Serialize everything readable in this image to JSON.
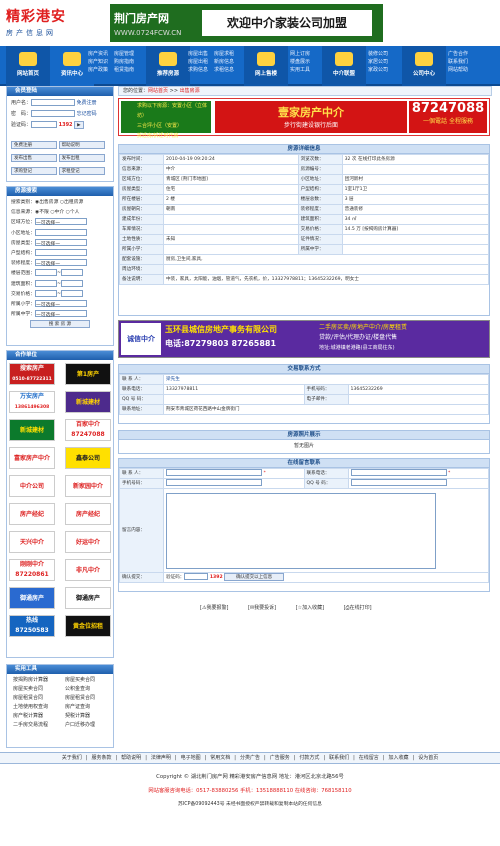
{
  "logo": {
    "main": "精彩港安",
    "sub": "房产信息网"
  },
  "banner_top": {
    "name": "荆门房产网",
    "url": "WWW.0724FCW.CN",
    "slogan": "欢迎中介家装公司加盟"
  },
  "nav": {
    "home": "网站首页",
    "news": "资讯中心",
    "recommend": "推荐房源",
    "online": "网上售楼",
    "agents": "中介联盟",
    "company": "公司中心",
    "cols": [
      [
        "房产资讯",
        "房产知识",
        "房产政策"
      ],
      [
        "房屋管理",
        "购房指南",
        "租赁指南"
      ],
      [
        "房屋指南",
        "评估指南",
        "市场走势"
      ],
      [
        "房屋出售",
        "房屋出租",
        "求购信息"
      ],
      [
        "房屋求租",
        "新房信息",
        "求租信息"
      ],
      [
        "网上订房",
        "楼盘展示",
        "实用工具"
      ],
      [
        "装修公司",
        "家居公司",
        "家政公司"
      ],
      [
        "广告合作",
        "联系我们",
        "网站帮助"
      ]
    ]
  },
  "breadcrumb": {
    "prefix": "您的位置：",
    "home": "网站首页",
    "sep": ">>",
    "current": "出售房源"
  },
  "login": {
    "title": "会员登陆",
    "user": "用户名：",
    "pwd": "密　码：",
    "code": "验证码：",
    "code_val": "1392",
    "reg": "免费注册",
    "forgot": "忘记密码",
    "btns": [
      "免费注册",
      "帮助说明",
      "发布出售",
      "发布出租",
      "求购登记",
      "求租登记"
    ]
  },
  "search": {
    "title": "房源搜索",
    "type": "搜索类别：",
    "type_opts": [
      "出售房源",
      "出租房源"
    ],
    "info": "信息来源：",
    "info_opts": [
      "不限",
      "中介",
      "个人"
    ],
    "area": "区域方位：",
    "sel": "—可选择—",
    "sub": "小区地址：",
    "house": "房屋类型：",
    "layout": "户型结构：",
    "deco": "装修程度：",
    "floor": "楼层范围：",
    "size": "建筑面积：",
    "price": "交易价格：",
    "school": "所属小学：",
    "mid": "所属中学：",
    "btn": "搜 索 房 源"
  },
  "partners": {
    "title": "合作单位",
    "ads": [
      "搜索房产",
      "第1房产",
      "万安房产",
      "百家中介",
      "新城建材",
      "富家房产中介",
      "鑫泰公司",
      "新家园中介",
      "中介公司",
      "房产经纪",
      "天兴中介",
      "好运中介",
      "刚刚中介",
      "非凡中介",
      "御通房产",
      "黄金位招租"
    ],
    "phones": [
      "0510-87722311",
      "13861496308",
      "87250583",
      "87247088",
      "87220861"
    ]
  },
  "tools": {
    "title": "实用工具",
    "items": [
      "按揭购房计算器",
      "房屋买卖合同",
      "房屋租赁合同",
      "公积金查询",
      "房屋买卖合同",
      "房屋租赁合同",
      "土地使用权查询",
      "房产证查询",
      "房产税计算器",
      "契税计算器",
      "二手房交易流程",
      "户口迁移办理"
    ]
  },
  "ad_main": {
    "l1": "求购以下房源：安置小区（立体坊）",
    "l2": "三合坪小区（安置）",
    "l3": "拆迁房/拆迁时代房",
    "brand": "壹家房产中介",
    "sub": "步行街建设银行后面",
    "phone": "87247088",
    "tag": "一個電話 全程服務"
  },
  "detail": {
    "title": "房源详细信息",
    "rows": [
      [
        "发布时间：",
        "2010-04-19 09:20:24",
        "浏览次数：",
        "32 次  在线打印此条房源"
      ],
      [
        "信息来源：",
        "中介",
        "房源编号：",
        ""
      ],
      [
        "区域方位：",
        "青城区  [荆门市地图]",
        "小区地址：",
        "团河新村"
      ],
      [
        "房屋类型：",
        "住宅",
        "户型结构：",
        "1室1厅1卫"
      ],
      [
        "所在楼层：",
        "2 楼",
        "楼层总数：",
        "3 层"
      ],
      [
        "房屋朝向：",
        "朝南",
        "装修程度：",
        "普通装修"
      ],
      [
        "建成年份：",
        "",
        "建筑面积：",
        "34 ㎡"
      ],
      [
        "车库情况：",
        "",
        "交易价格：",
        "14.5 万  [按揭购房计算器]"
      ],
      [
        "土地性质：",
        "未知",
        "证件情况：",
        ""
      ],
      [
        "所属小学：",
        "",
        "所属中学：",
        ""
      ],
      [
        "配套设施：",
        "厨房,卫生间,家具,",
        "",
        " "
      ],
      [
        "周边环境：",
        "",
        "",
        " "
      ],
      [
        "备注说明：",
        "中装，家具，太阳能，油烟，管道气，先农机，价，13327978811；13645232269，明女士",
        "",
        ""
      ]
    ]
  },
  "ad_mid": {
    "l1": "玉环县城信房地产事务有限公司",
    "l2": "二手房买卖/房地产中介/房屋租赁",
    "l3": "贷款/评估/代理办证/楼盘代售",
    "slogan": "诚信中介",
    "phone": "电话:87279803  87265881",
    "addr": "地址:城港镇老港路(县工商局往东)"
  },
  "contact": {
    "title": "交易联系方式",
    "name_k": "联 系 人：",
    "name": "梁先生",
    "tel_k": "联系电话：",
    "tel": "13327978811",
    "mob_k": "手机号码：",
    "mob": "13645232269",
    "qq_k": "QQ 号 码：",
    "qq": "",
    "email_k": "电子邮件：",
    "email": "",
    "addr_k": "联系地址：",
    "addr": "荆安市青城区荷花西路中山金牌街门"
  },
  "photos": {
    "title": "房源照片展示",
    "empty": "暂无图片"
  },
  "message": {
    "title": "在线留言联系",
    "name": "联 系 人：",
    "tel": "联系电话：",
    "mobile": "手机号码：",
    "qq": "QQ 号 码：",
    "content": "留言内容：",
    "confirm": "确认提交：",
    "code_lbl": "验证码：",
    "code": "1392",
    "submit": "确认提交以上信息"
  },
  "actions": [
    "我要报警",
    "我要投诉",
    "加入收藏",
    "在线打印"
  ],
  "footer": {
    "links": [
      "关于我们",
      "服务条款",
      "帮助说明",
      "法律声明",
      "电子地图",
      "常用文档",
      "分类广告",
      "广告服务",
      "付款方式",
      "联系我们",
      "在线留言",
      "加入收藏",
      "设为首页"
    ],
    "copyright": "Copyright © 湖北荆门房产网  精彩港安房产信息网  地址：港河区北京北路56号",
    "hotline": "网站客服咨询电话：0517-83880256  手机：13518888110  在线咨询：768158110",
    "icp": "苏ICP备09092443号  未经书面授权严禁转载和复制本站的任何信息"
  }
}
